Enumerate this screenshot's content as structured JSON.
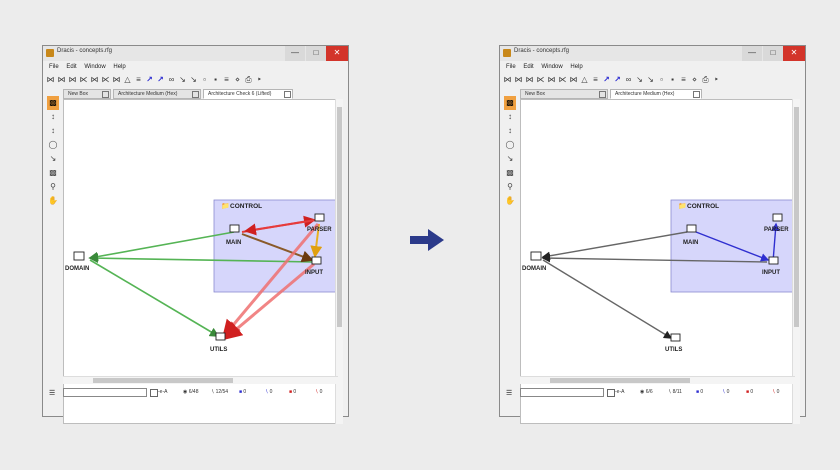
{
  "windows": [
    {
      "id": "left",
      "title": "Dracis - concepts.rfg",
      "menus": [
        "File",
        "Edit",
        "Window",
        "Help"
      ],
      "tabs": [
        "New Box",
        "Architecture Medium (Hex)",
        "Architecture Check 6 (Lifted)"
      ],
      "active_tab": 2,
      "stats": [
        "6/48",
        "12/54",
        "0",
        "0",
        "0",
        "0"
      ],
      "regex_label": "-e-A",
      "group_label": "CONTROL",
      "nodes": [
        "MAIN",
        "PARSER",
        "INPUT",
        "DOMAIN",
        "UTILS"
      ]
    },
    {
      "id": "right",
      "title": "Dracis - concepts.rfg",
      "menus": [
        "File",
        "Edit",
        "Window",
        "Help"
      ],
      "tabs": [
        "New Box",
        "Architecture Medium (Hex)"
      ],
      "active_tab": 1,
      "stats": [
        "6/6",
        "8/11",
        "0",
        "0",
        "0",
        "0"
      ],
      "regex_label": "-e-A",
      "group_label": "CONTROL",
      "nodes": [
        "MAIN",
        "PARSER",
        "INPUT",
        "DOMAIN",
        "UTILS"
      ]
    }
  ],
  "colors": {
    "group_fill": "#d6d6fb",
    "green_edge": "#55b455",
    "red_edge": "#e63c3c",
    "brown_edge": "#8a5a2a",
    "blue_edge": "#2f2fd0",
    "black_edge": "#555555",
    "arrow_between": "#2b3a8a"
  },
  "icons": {
    "arrow_between": "right-arrow-icon"
  }
}
